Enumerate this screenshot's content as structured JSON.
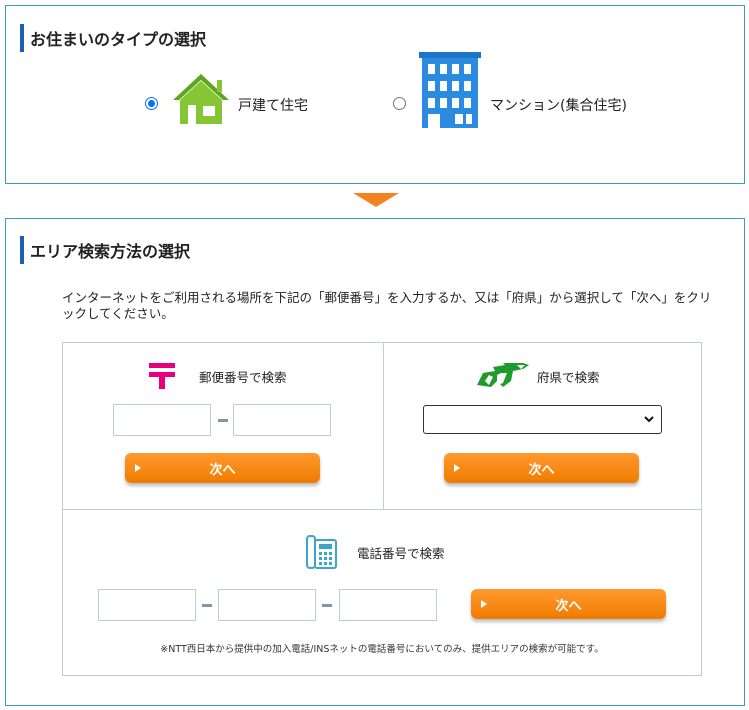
{
  "housing_type": {
    "heading": "お住まいのタイプの選択",
    "options": [
      {
        "label": "戸建て住宅",
        "icon": "house-icon",
        "selected": true
      },
      {
        "label": "マンション(集合住宅)",
        "icon": "building-icon",
        "selected": false
      }
    ]
  },
  "area_search": {
    "heading": "エリア検索方法の選択",
    "instruction": "インターネットをご利用される場所を下記の「郵便番号」を入力するか、又は「府県」から選択して「次へ」をクリックしてください。",
    "postal": {
      "title": "郵便番号で検索",
      "icon": "postal-mark-icon",
      "button_label": "次へ"
    },
    "prefecture": {
      "title": "府県で検索",
      "icon": "prefecture-map-icon",
      "button_label": "次へ",
      "selected_value": ""
    },
    "phone": {
      "title": "電話番号で検索",
      "icon": "telephone-icon",
      "button_label": "次へ",
      "note": "※NTT西日本から提供中の加入電話/INSネットの電話番号においてのみ、提供エリアの検索が可能です。"
    }
  },
  "colors": {
    "accent_orange": "#f58220",
    "panel_border": "#3a9bc9",
    "heading_bar": "#1a5fb4",
    "postal_red": "#e6007e",
    "map_green": "#1f9a2c"
  }
}
